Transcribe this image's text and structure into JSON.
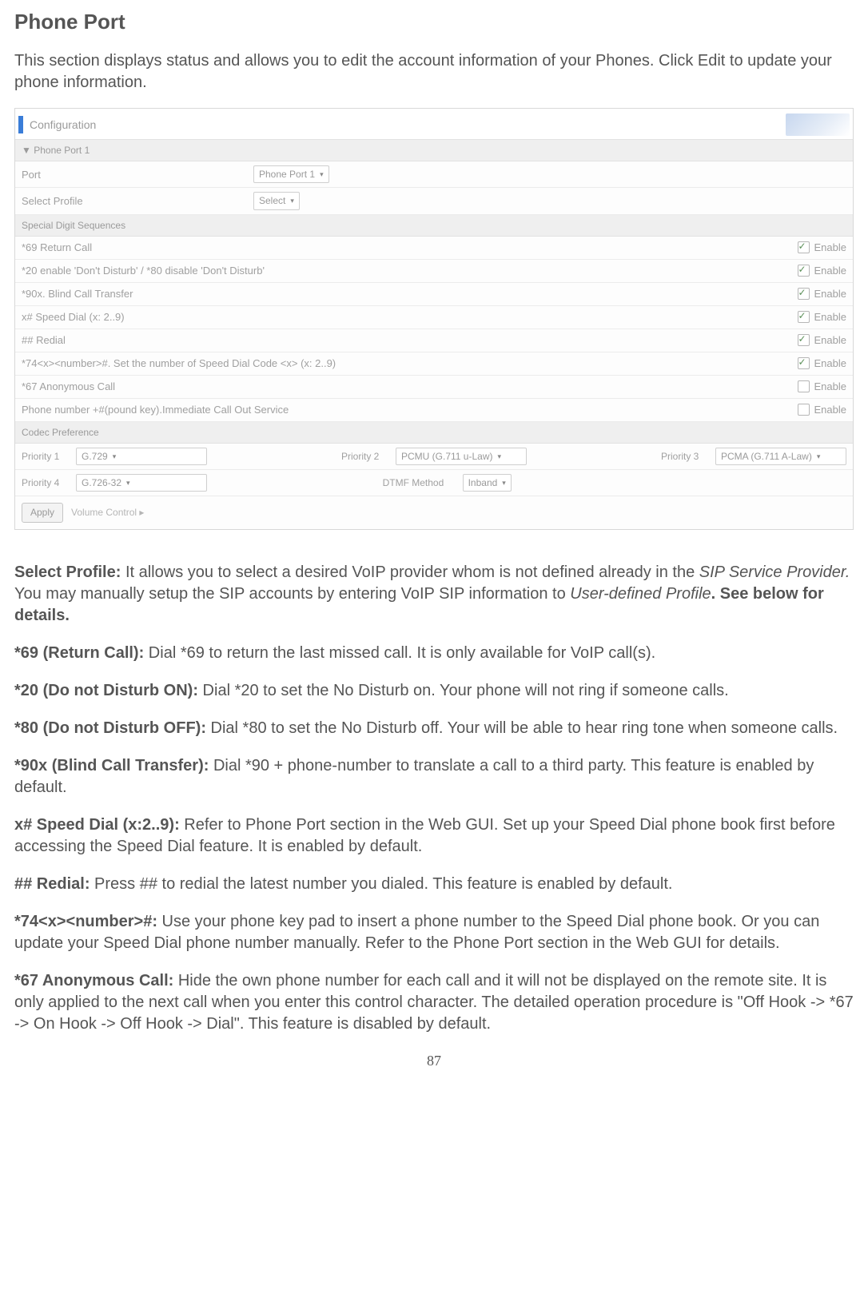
{
  "title": "Phone Port",
  "intro": "This section displays status and allows you to edit the account information of your Phones. Click Edit to update your phone information.",
  "config": {
    "header": "Configuration",
    "section1": "▼ Phone Port 1",
    "port_label": "Port",
    "port_value": "Phone Port 1",
    "profile_label": "Select Profile",
    "profile_value": "Select",
    "section2": "Special Digit Sequences",
    "rows": [
      {
        "label": "*69 Return Call",
        "checked": true
      },
      {
        "label": "*20 enable 'Don't Disturb' / *80 disable 'Don't Disturb'",
        "checked": true
      },
      {
        "label": "*90x. Blind Call Transfer",
        "checked": true
      },
      {
        "label": "x# Speed Dial (x: 2..9)",
        "checked": true
      },
      {
        "label": "## Redial",
        "checked": true
      },
      {
        "label": "*74<x><number>#. Set the number of Speed Dial Code <x> (x: 2..9)",
        "checked": true
      },
      {
        "label": "*67 Anonymous Call",
        "checked": false
      },
      {
        "label": "Phone number +#(pound key).Immediate Call Out Service",
        "checked": false
      }
    ],
    "enable_label": "Enable",
    "section3": "Codec Preference",
    "codec": {
      "p1": "Priority 1",
      "p1v": "G.729",
      "p2": "Priority 2",
      "p2v": "PCMU (G.711 u-Law)",
      "p3": "Priority 3",
      "p3v": "PCMA (G.711 A-Law)",
      "p4": "Priority 4",
      "p4v": "G.726-32",
      "dtmf": "DTMF Method",
      "dtmfv": "Inband"
    },
    "apply": "Apply",
    "volume": "Volume Control ▸"
  },
  "paras": {
    "sp_head": "Select Profile:",
    "sp_body1": "  It allows you to select a desired VoIP provider whom is not defined already in the ",
    "sp_i1": "SIP Service Provider.",
    "sp_body2": "  You may manually setup the SIP accounts by entering VoIP SIP information to ",
    "sp_i2": "User-defined Profile",
    "sp_body3": ".  See below for details.",
    "p69_head": "*69 (Return Call):",
    "p69_body": " Dial *69 to return the last missed call. It is only available for VoIP call(s).",
    "p20_head": "*20 (Do not Disturb ON):",
    "p20_body": " Dial *20 to set the No Disturb on. Your phone will not ring if someone calls.",
    "p80_head": "*80 (Do not Disturb OFF):",
    "p80_body": " Dial *80 to set the No Disturb off. Your will be able to hear ring tone when someone calls.",
    "p90_head": "*90x (Blind Call Transfer):",
    "p90_body": " Dial *90 + phone-number to translate a call to a third party. This feature is enabled by default.",
    "pxs_head": "x# Speed Dial (x:2..9):",
    "pxs_body": " Refer to Phone Port section in the Web GUI. Set up your Speed Dial phone book first before accessing the Speed Dial feature. It is enabled by default.",
    "prd_head": "## Redial:",
    "prd_body": " Press ## to redial the latest number you dialed. This feature is enabled by default.",
    "p74_head": "*74<x><number>#:",
    "p74_body": " Use your phone key pad to insert a phone number to the Speed Dial phone book. Or you can update your Speed Dial phone number manually. Refer to the Phone Port section in the Web GUI for details.",
    "p67_head": "*67 Anonymous Call:",
    "p67_body": " Hide the own phone number for each call and it will not be displayed on the remote site. It is only applied to the next call when you enter this control character. The detailed operation procedure is \"Off Hook -> *67 -> On Hook -> Off Hook -> Dial\". This feature is disabled by default."
  },
  "pagenum": "87"
}
